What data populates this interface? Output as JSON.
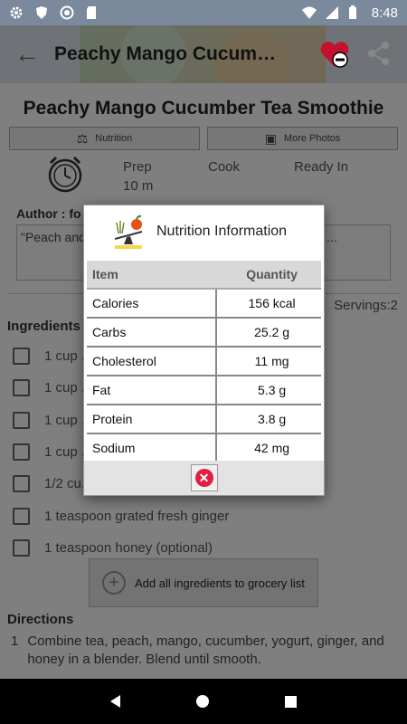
{
  "status_bar": {
    "time": "8:48"
  },
  "app_bar": {
    "title": "Peachy Mango Cucumber Tea Smoothie"
  },
  "recipe": {
    "title": "Peachy Mango Cucumber Tea Smoothie",
    "tabs": {
      "nutrition_label": "Nutrition",
      "photos_label": "More Photos"
    },
    "times": {
      "prep_label": "Prep",
      "prep_value": "10 m",
      "cook_label": "Cook",
      "ready_label": "Ready In"
    },
    "author_label": "Author : fo",
    "description": "\"Peach and ... color, while cucu... of yogurt and ginger ...",
    "servings": "Servings:2",
    "ingredients_heading": "Ingredients",
    "ingredients": [
      "1 cup ... ), chilled",
      "1 cup ...",
      "1 cup ...",
      "1 cup ...",
      "1/2 cu...",
      "1 teaspoon grated fresh ginger",
      "1 teaspoon honey (optional)"
    ],
    "grocery_button": "Add all ingredients to grocery list",
    "directions_heading": "Directions",
    "directions": [
      {
        "number": "1",
        "text": "Combine tea, peach, mango, cucumber, yogurt, ginger, and honey in a blender. Blend until smooth."
      }
    ]
  },
  "dialog": {
    "title": "Nutrition Information",
    "logo_text": "NUTRITION",
    "col_item": "Item",
    "col_quantity": "Quantity",
    "rows": [
      {
        "item": "Calories",
        "quantity": "156 kcal"
      },
      {
        "item": "Carbs",
        "quantity": "25.2 g"
      },
      {
        "item": "Cholesterol",
        "quantity": "11 mg"
      },
      {
        "item": "Fat",
        "quantity": "5.3 g"
      },
      {
        "item": "Protein",
        "quantity": "3.8 g"
      },
      {
        "item": "Sodium",
        "quantity": "42 mg"
      }
    ]
  },
  "colors": {
    "accent_red": "#e02040",
    "status_bar": "#7a8a9c"
  }
}
